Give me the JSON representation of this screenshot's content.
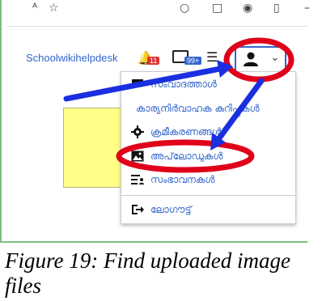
{
  "header": {
    "username": "Schoolwikihelpdesk",
    "notification_count": "11",
    "notice_count": "99+"
  },
  "menu": {
    "items": [
      {
        "label": "സംവാദത്താൾ",
        "icon": "speech-bubble-icon"
      },
      {
        "label": "കാര്യനിർവാഹക കുറിപ്പുകൾ",
        "icon": ""
      },
      {
        "label": "ക്രമീകരണങ്ങൾ",
        "icon": "gear-icon"
      },
      {
        "label": "അപ്‌ലോഡുകൾ",
        "icon": "image-icon"
      },
      {
        "label": "സംഭാവനകൾ",
        "icon": "contributions-icon"
      },
      {
        "label": "ലോഗൗട്ട്",
        "icon": "logout-icon"
      }
    ]
  },
  "caption": "Figure 19: Find uploaded image files",
  "colors": {
    "link": "#3366cc",
    "annotation_red": "#e0001a",
    "annotation_blue": "#1a2fe0",
    "note_yellow": "#ffff88"
  }
}
